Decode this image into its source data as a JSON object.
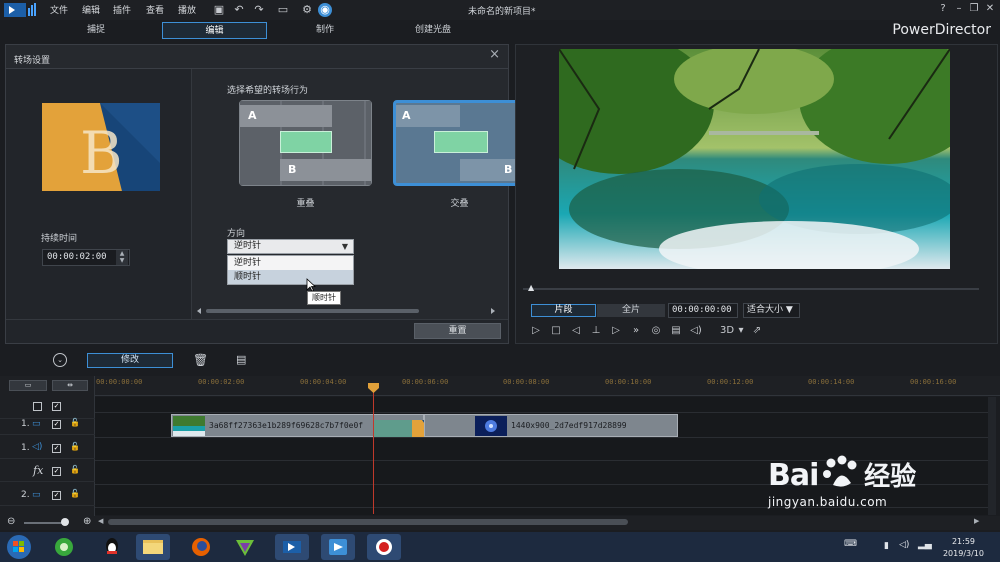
{
  "menu": {
    "items": [
      "文件",
      "编辑",
      "插件",
      "查看",
      "播放"
    ],
    "title": "未命名的新项目*"
  },
  "mode_tabs": [
    "捕捉",
    "编辑",
    "制作",
    "创建光盘"
  ],
  "brand": "PowerDirector",
  "dialog": {
    "title": "转场设置",
    "duration_label": "持续时间",
    "duration_value": "00:00:02:00",
    "behavior_label": "选择希望的转场行为",
    "options": [
      {
        "label": "重叠",
        "a": "A",
        "b": "B"
      },
      {
        "label": "交叠",
        "a": "A",
        "b": "B"
      }
    ],
    "direction_label": "方向",
    "direction_selected": "逆时针",
    "direction_options": [
      "逆时针",
      "顺时针"
    ],
    "tooltip": "顺时针",
    "reset_label": "重置"
  },
  "preview": {
    "segment_label": "片段",
    "full_label": "全片",
    "timecode": "00:00:00:00",
    "fit_label": "适合大小",
    "three_d_label": "3D"
  },
  "timeline": {
    "modify_label": "修改",
    "ticks": [
      "00:00:00:00",
      "00:00:02:00",
      "00:00:04:00",
      "00:00:06:00",
      "00:00:08:00",
      "00:00:10:00",
      "00:00:12:00",
      "00:00:14:00",
      "00:00:16:00"
    ],
    "tracks": [
      {
        "num": ""
      },
      {
        "num": "1."
      },
      {
        "num": "1."
      },
      {
        "num": "fx"
      },
      {
        "num": "2."
      }
    ],
    "clips": [
      {
        "name": "3a68ff27363e1b289f69628c7b7f0e0f"
      },
      {
        "name": "1440x900_2d7edf917d28899"
      }
    ]
  },
  "taskbar": {
    "time": "21:59",
    "date": "2019/3/10"
  },
  "watermark": {
    "brand": "Bai",
    "brand_cn": "经验",
    "url": "jingyan.baidu.com"
  },
  "colors": {
    "accent": "#3d8fd6",
    "transition_green": "#7fd3a4",
    "playhead": "#c0392b"
  }
}
